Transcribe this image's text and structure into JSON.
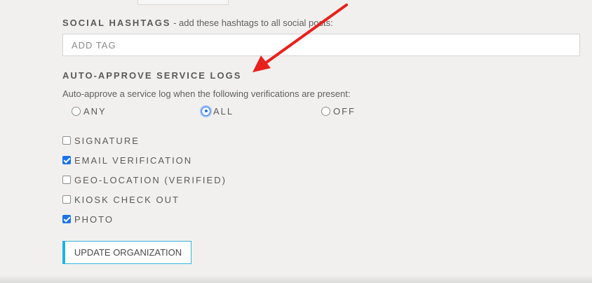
{
  "social_hashtags": {
    "heading": "SOCIAL HASHTAGS",
    "hint": " - add these hashtags to all social posts:",
    "input_placeholder": "ADD TAG",
    "input_value": ""
  },
  "auto_approve": {
    "heading": "AUTO-APPROVE SERVICE LOGS",
    "description": "Auto-approve a service log when the following verifications are present:",
    "options": [
      {
        "label": "ANY",
        "checked": false
      },
      {
        "label": "ALL",
        "checked": true
      },
      {
        "label": "OFF",
        "checked": false
      }
    ],
    "verifications": [
      {
        "label": "SIGNATURE",
        "checked": false
      },
      {
        "label": "EMAIL VERIFICATION",
        "checked": true
      },
      {
        "label": "GEO-LOCATION (VERIFIED)",
        "checked": false
      },
      {
        "label": "KIOSK CHECK OUT",
        "checked": false
      },
      {
        "label": "PHOTO",
        "checked": true
      }
    ]
  },
  "actions": {
    "update_label": "UPDATE ORGANIZATION"
  },
  "colors": {
    "accent": "#1cb4e0",
    "checkbox_checked": "#1a73e8",
    "annotation_arrow": "#e8211c"
  }
}
